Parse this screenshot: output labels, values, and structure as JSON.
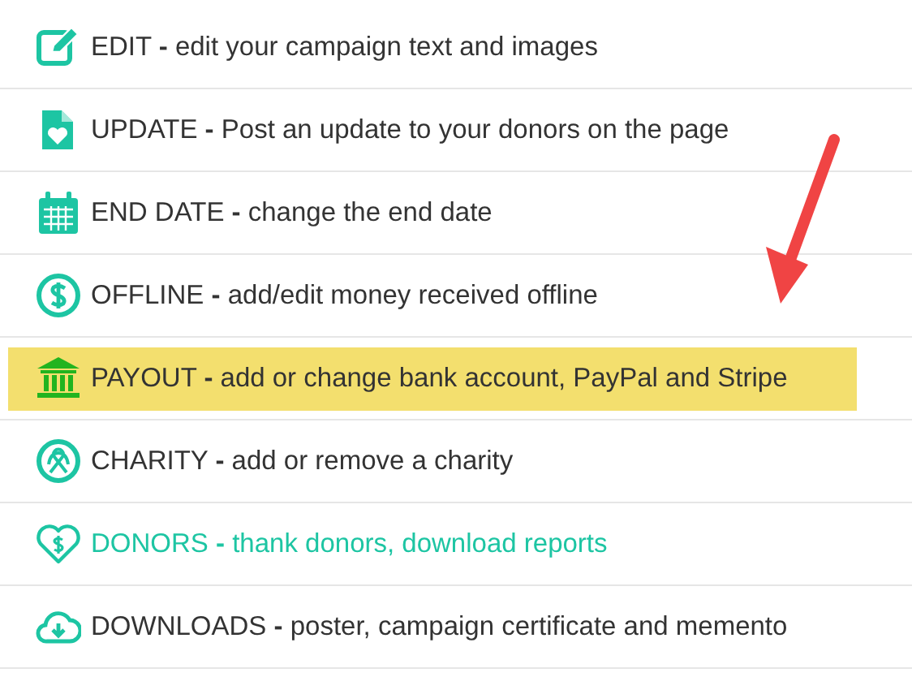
{
  "menu": [
    {
      "kind": "edit",
      "text": "EDIT **-** edit your campaign text and images",
      "highlighted": false,
      "active": false
    },
    {
      "kind": "update",
      "text": "UPDATE **-** Post an update to your donors on the page",
      "highlighted": false,
      "active": false
    },
    {
      "kind": "calendar",
      "text": "END DATE **-** change the end date",
      "highlighted": false,
      "active": false
    },
    {
      "kind": "dollar",
      "text": "OFFLINE **-** add/edit money received offline",
      "highlighted": false,
      "active": false
    },
    {
      "kind": "bank",
      "text": "PAYOUT **-** add or change bank account, PayPal and Stripe",
      "highlighted": true,
      "active": false
    },
    {
      "kind": "ribbon",
      "text": "CHARITY **-** add or remove a charity",
      "highlighted": false,
      "active": false
    },
    {
      "kind": "heart",
      "text": "DONORS **-** thank donors, download reports",
      "highlighted": false,
      "active": true
    },
    {
      "kind": "cloud",
      "text": "DOWNLOADS **-** poster, campaign certificate and memento",
      "highlighted": false,
      "active": false
    }
  ]
}
